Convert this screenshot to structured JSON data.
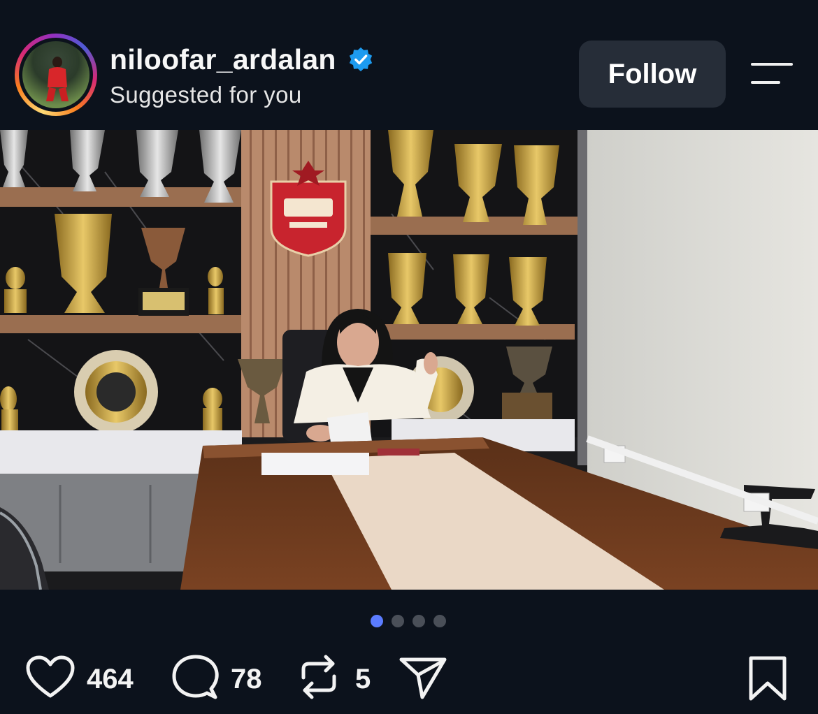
{
  "post": {
    "username": "niloofar_ardalan",
    "verified": true,
    "subtitle": "Suggested for you",
    "follow_label": "Follow",
    "image": {
      "description_icon": "photo",
      "carousel": {
        "total": 4,
        "active_index": 0
      }
    },
    "actions": {
      "likes": "464",
      "comments": "78",
      "reposts": "5"
    }
  },
  "icons": {
    "verified": "verified-badge-icon",
    "menu": "menu-icon",
    "like": "heart-icon",
    "comment": "comment-bubble-icon",
    "repost": "repost-icon",
    "share": "send-icon",
    "save": "bookmark-icon"
  },
  "colors": {
    "background": "#0c121c",
    "follow_button": "#262d38",
    "verified_blue": "#1d9bf0",
    "carousel_active": "#5b7cff",
    "carousel_inactive": "#4a4f58"
  }
}
